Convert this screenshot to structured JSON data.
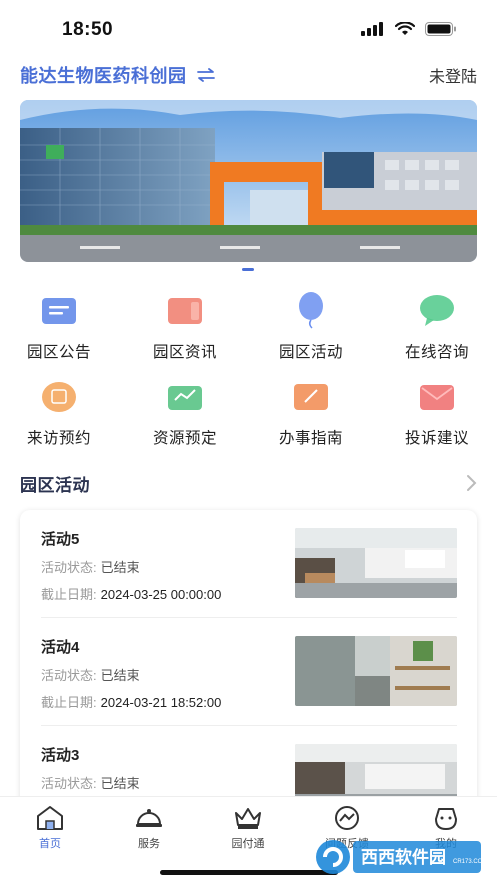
{
  "status_bar": {
    "time": "18:50"
  },
  "header": {
    "park_name": "能达生物医药科创园",
    "login_status": "未登陆"
  },
  "grid": [
    {
      "label": "园区公告",
      "icon": "notice-icon",
      "color": "#5b84e8"
    },
    {
      "label": "园区资讯",
      "icon": "news-icon",
      "color": "#f07b6b"
    },
    {
      "label": "园区活动",
      "icon": "balloon-icon",
      "color": "#6a8ff0"
    },
    {
      "label": "在线咨询",
      "icon": "chat-icon",
      "color": "#4fc98a"
    },
    {
      "label": "来访预约",
      "icon": "calendar-icon",
      "color": "#f3a256"
    },
    {
      "label": "资源预定",
      "icon": "resource-icon",
      "color": "#4fbf7e"
    },
    {
      "label": "办事指南",
      "icon": "guide-icon",
      "color": "#f18a4f"
    },
    {
      "label": "投诉建议",
      "icon": "mail-icon",
      "color": "#ef6b6b"
    }
  ],
  "section": {
    "title": "园区活动"
  },
  "activity_labels": {
    "status": "活动状态:",
    "deadline": "截止日期:"
  },
  "activities": [
    {
      "title": "活动5",
      "status": "已结束",
      "deadline": "2024-03-25 00:00:00"
    },
    {
      "title": "活动4",
      "status": "已结束",
      "deadline": "2024-03-21 18:52:00"
    },
    {
      "title": "活动3",
      "status": "已结束",
      "deadline": ""
    }
  ],
  "tabs": [
    {
      "label": "首页",
      "icon": "home-icon",
      "active": true
    },
    {
      "label": "服务",
      "icon": "service-bell-icon",
      "active": false
    },
    {
      "label": "园付通",
      "icon": "crown-icon",
      "active": false
    },
    {
      "label": "问题反馈",
      "icon": "feedback-icon",
      "active": false
    },
    {
      "label": "我的",
      "icon": "profile-icon",
      "active": false
    }
  ],
  "watermark": {
    "text": "西西软件园",
    "subtext": "CR173.COM"
  },
  "colors": {
    "accent": "#4a6fd6"
  }
}
